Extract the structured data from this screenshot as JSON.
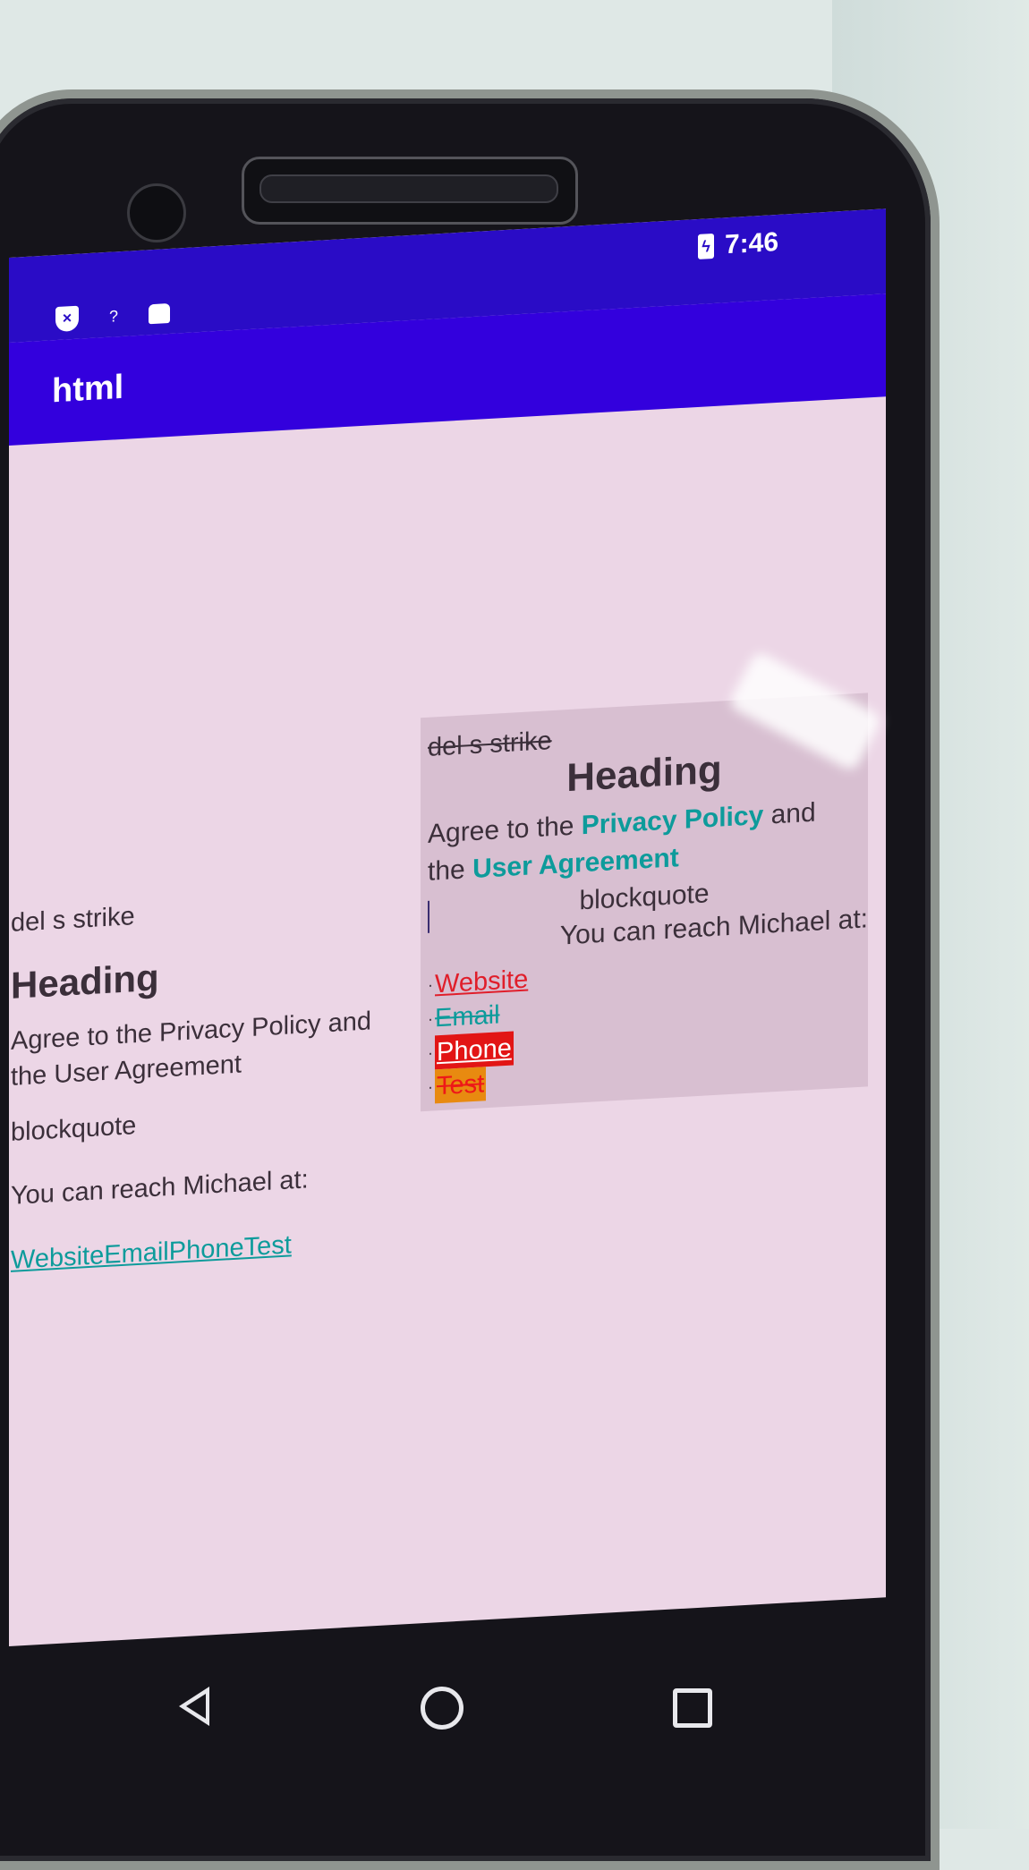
{
  "status_bar": {
    "time": "7:46",
    "left_icons": [
      "shield-icon",
      "question-icon",
      "robot-icon"
    ],
    "battery_icon": "battery-charging-icon"
  },
  "app_bar": {
    "title": "html"
  },
  "left_column": {
    "del_s_strike": "del s strike",
    "heading": "Heading",
    "agree_line1": "Agree to the Privacy Policy and",
    "agree_line2": "the User Agreement",
    "blockquote": "blockquote",
    "reach": "You can reach Michael at:",
    "links": "WebsiteEmailPhoneTest"
  },
  "right_panel": {
    "del_s_strike": "del s strike",
    "heading": "Heading",
    "agree_prefix": "Agree to the",
    "privacy_link": "Privacy Policy",
    "and_text": "and",
    "the_text": "the",
    "user_agreement_link": "User Agreement",
    "blockquote": "blockquote",
    "reach": "You can reach Michael at:",
    "bullet": "·",
    "items": {
      "website": "Website",
      "email": "Email",
      "phone": "Phone",
      "test": "Test"
    }
  },
  "nav_bar": {
    "back_icon": "back-triangle-icon",
    "home_icon": "home-circle-icon",
    "recents_icon": "recents-square-icon"
  },
  "colors": {
    "status_bar": "#2a0cc6",
    "app_bar": "#3300dd",
    "screen_bg": "#ecd6e6",
    "link_teal": "#0d9b9b",
    "link_red": "#e01e2a",
    "phone_bg": "#e21515",
    "test_bg": "#e88a10"
  }
}
